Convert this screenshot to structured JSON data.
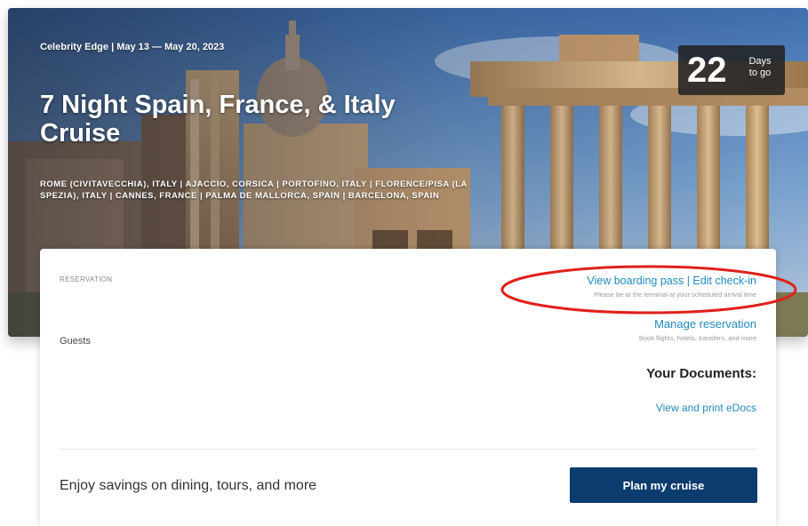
{
  "hero": {
    "ship_date": "Celebrity Edge | May 13 — May 20, 2023",
    "title": "7 Night Spain, France, & Italy Cruise",
    "ports": "ROME (CIVITAVECCHIA), ITALY | AJACCIO, CORSICA | PORTOFINO, ITALY | FLORENCE/PISA (LA SPEZIA), ITALY | CANNES, FRANCE | PALMA DE MALLORCA, SPAIN | BARCELONA, SPAIN",
    "countdown": {
      "number": "22",
      "unit_line1": "Days",
      "unit_line2": "to go"
    }
  },
  "reservation": {
    "label": "RESERVATION",
    "guests_label": "Guests",
    "boarding_pass_link": "View boarding pass | Edit check-in",
    "boarding_pass_hint": "Please be at the terminal at your scheduled arrival time",
    "manage_link": "Manage reservation",
    "manage_hint": "Book flights, hotels, transfers, and more"
  },
  "documents": {
    "title": "Your Documents:",
    "edocs_link": "View and print eDocs"
  },
  "promo": {
    "text": "Enjoy savings on dining, tours, and more",
    "button_label": "Plan my cruise"
  },
  "colors": {
    "link": "#1f8bbf",
    "button": "#0b3c6f",
    "annotation": "#e0201b"
  }
}
